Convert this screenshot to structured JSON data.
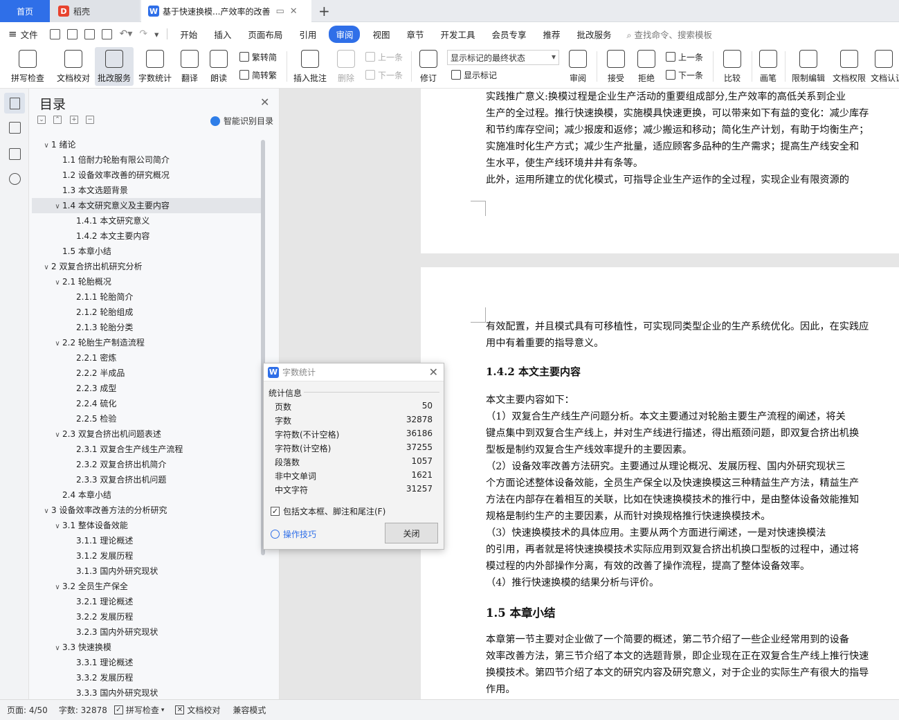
{
  "tabs": {
    "home": "首页",
    "daoke": "稻壳",
    "document": "基于快速换模...产效率的改善",
    "add": "+"
  },
  "menu": {
    "file": "文件",
    "items": [
      "开始",
      "插入",
      "页面布局",
      "引用",
      "审阅",
      "视图",
      "章节",
      "开发工具",
      "会员专享",
      "推荐",
      "批改服务"
    ],
    "active": "审阅",
    "search": "查找命令、搜索模板"
  },
  "ribbon": {
    "spellcheck": "拼写检查",
    "doc_check": "文档校对",
    "correct_service": "批改服务",
    "word_count": "字数统计",
    "translate": "翻译",
    "read_aloud": "朗读",
    "to_traditional": "繁转简",
    "to_simplified": "简转繁",
    "insert_comment": "插入批注",
    "delete": "删除",
    "prev_comment": "上一条",
    "next_comment": "下一条",
    "revise": "修订",
    "markup_select": "显示标记的最终状态",
    "show_markup": "显示标记",
    "review": "审阅",
    "accept": "接受",
    "reject": "拒绝",
    "prev_change": "上一条",
    "next_change": "下一条",
    "compare": "比较",
    "pen": "画笔",
    "restrict_edit": "限制编辑",
    "doc_permission": "文档权限",
    "doc_cert": "文档认证"
  },
  "toc": {
    "title": "目录",
    "smart": "智能识别目录",
    "items": [
      {
        "text": "1  绪论",
        "level": 1,
        "chev": true
      },
      {
        "text": "1.1  倍耐力轮胎有限公司简介",
        "level": 2,
        "chev": false
      },
      {
        "text": "1.2  设备效率改善的研究概况",
        "level": 2,
        "chev": false
      },
      {
        "text": "1.3  本文选题背景",
        "level": 2,
        "chev": false
      },
      {
        "text": "1.4  本文研究意义及主要内容",
        "level": 2,
        "chev": true,
        "selected": true
      },
      {
        "text": "1.4.1  本文研究意义",
        "level": 3,
        "chev": false
      },
      {
        "text": "1.4.2  本文主要内容",
        "level": 3,
        "chev": false
      },
      {
        "text": "1.5  本章小结",
        "level": 2,
        "chev": false
      },
      {
        "text": "2  双复合挤出机研究分析",
        "level": 1,
        "chev": true
      },
      {
        "text": "2.1  轮胎概况",
        "level": 2,
        "chev": true
      },
      {
        "text": "2.1.1  轮胎简介",
        "level": 3,
        "chev": false
      },
      {
        "text": "2.1.2  轮胎组成",
        "level": 3,
        "chev": false
      },
      {
        "text": "2.1.3  轮胎分类",
        "level": 3,
        "chev": false
      },
      {
        "text": "2.2  轮胎生产制造流程",
        "level": 2,
        "chev": true
      },
      {
        "text": "2.2.1  密炼",
        "level": 3,
        "chev": false
      },
      {
        "text": "2.2.2  半成品",
        "level": 3,
        "chev": false
      },
      {
        "text": "2.2.3  成型",
        "level": 3,
        "chev": false
      },
      {
        "text": "2.2.4  硫化",
        "level": 3,
        "chev": false
      },
      {
        "text": "2.2.5  检验",
        "level": 3,
        "chev": false
      },
      {
        "text": "2.3  双复合挤出机问题表述",
        "level": 2,
        "chev": true
      },
      {
        "text": "2.3.1  双复合生产线生产流程",
        "level": 3,
        "chev": false
      },
      {
        "text": "2.3.2  双复合挤出机简介",
        "level": 3,
        "chev": false
      },
      {
        "text": "2.3.3  双复合挤出机问题",
        "level": 3,
        "chev": false
      },
      {
        "text": "2.4  本章小结",
        "level": 2,
        "chev": false
      },
      {
        "text": "3  设备效率改善方法的分析研究",
        "level": 1,
        "chev": true
      },
      {
        "text": "3.1  整体设备效能",
        "level": 2,
        "chev": true
      },
      {
        "text": "3.1.1  理论概述",
        "level": 3,
        "chev": false
      },
      {
        "text": "3.1.2  发展历程",
        "level": 3,
        "chev": false
      },
      {
        "text": "3.1.3  国内外研究现状",
        "level": 3,
        "chev": false
      },
      {
        "text": "3.2  全员生产保全",
        "level": 2,
        "chev": true
      },
      {
        "text": "3.2.1  理论概述",
        "level": 3,
        "chev": false
      },
      {
        "text": "3.2.2  发展历程",
        "level": 3,
        "chev": false
      },
      {
        "text": "3.2.3  国内外研究现状",
        "level": 3,
        "chev": false
      },
      {
        "text": "3.3  快速换模",
        "level": 2,
        "chev": true
      },
      {
        "text": "3.3.1  理论概述",
        "level": 3,
        "chev": false
      },
      {
        "text": "3.3.2  发展历程",
        "level": 3,
        "chev": false
      },
      {
        "text": "3.3.3  国内外研究现状",
        "level": 3,
        "chev": false
      }
    ]
  },
  "document": {
    "page1_lines": [
      "    实践推广意义:换模过程是企业生产活动的重要组成部分,生产效率的高低关系到企业",
      "生产的全过程。推行快速换模，实施模具快速更换，可以带来如下有益的变化：减少库存",
      "和节约库存空间；减少报废和返修；减少搬运和移动；简化生产计划，有助于均衡生产；",
      "实施准时化生产方式；减少生产批量，适应顾客多品种的生产需求；提高生产线安全和",
      "生水平，使生产线环境井井有条等。",
      "    此外，运用所建立的优化模式，可指导企业生产运作的全过程，实现企业有限资源的"
    ],
    "page2_intro": [
      "有效配置，并且模式具有可移植性，可实现同类型企业的生产系统优化。因此，在实践应",
      "用中有着重要的指导意义。"
    ],
    "heading_142": "1.4.2  本文主要内容",
    "body_142": [
      "    本文主要内容如下：",
      "    （1）双复合生产线生产问题分析。本文主要通过对轮胎主要生产流程的阐述，将关",
      "键点集中到双复合生产线上，并对生产线进行描述，得出瓶颈问题，即双复合挤出机换",
      "型板是制约双复合生产线效率提升的主要因素。",
      "    （2）设备效率改善方法研究。主要通过从理论概况、发展历程、国内外研究现状三",
      "个方面论述整体设备效能，全员生产保全以及快速换模这三种精益生产方法，精益生产",
      "方法在内部存在着相互的关联，比如在快速换模技术的推行中，是由整体设备效能推知",
      "规格是制约生产的主要因素，从而针对换规格推行快速换模技术。",
      "    （3）快速换模技术的具体应用。主要从两个方面进行阐述，一是对快速换模法",
      "的引用，再者就是将快速换模技术实际应用到双复合挤出机换口型板的过程中，通过将",
      "模过程的内外部操作分离，有效的改善了操作流程，提高了整体设备效率。",
      "    （4）推行快速换模的结果分析与评价。"
    ],
    "heading_15": "1.5  本章小结",
    "body_15": [
      "    本章第一节主要对企业做了一个简要的概述，第二节介绍了一些企业经常用到的设备",
      "效率改善方法，第三节介绍了本文的选题背景，即企业现在正在双复合生产线上推行快速",
      "换模技术。第四节介绍了本文的研究内容及研究意义，对于企业的实际生产有很大的指导",
      "作用。"
    ]
  },
  "dialog": {
    "title": "字数统计",
    "section": "统计信息",
    "rows": [
      {
        "label": "页数",
        "value": "50"
      },
      {
        "label": "字数",
        "value": "32878"
      },
      {
        "label": "字符数(不计空格)",
        "value": "36186"
      },
      {
        "label": "字符数(计空格)",
        "value": "37255"
      },
      {
        "label": "段落数",
        "value": "1057"
      },
      {
        "label": "非中文单词",
        "value": "1621"
      },
      {
        "label": "中文字符",
        "value": "31257"
      }
    ],
    "include_label": "包括文本框、脚注和尾注(F)",
    "tips": "操作技巧",
    "close_button": "关闭"
  },
  "status": {
    "page": "页面: 4/50",
    "words": "字数: 32878",
    "spell": "拼写检查",
    "doc_check": "文档校对",
    "compat": "兼容模式"
  },
  "colors": {
    "accent": "#2f6fe8",
    "wps_red": "#e8432e"
  }
}
